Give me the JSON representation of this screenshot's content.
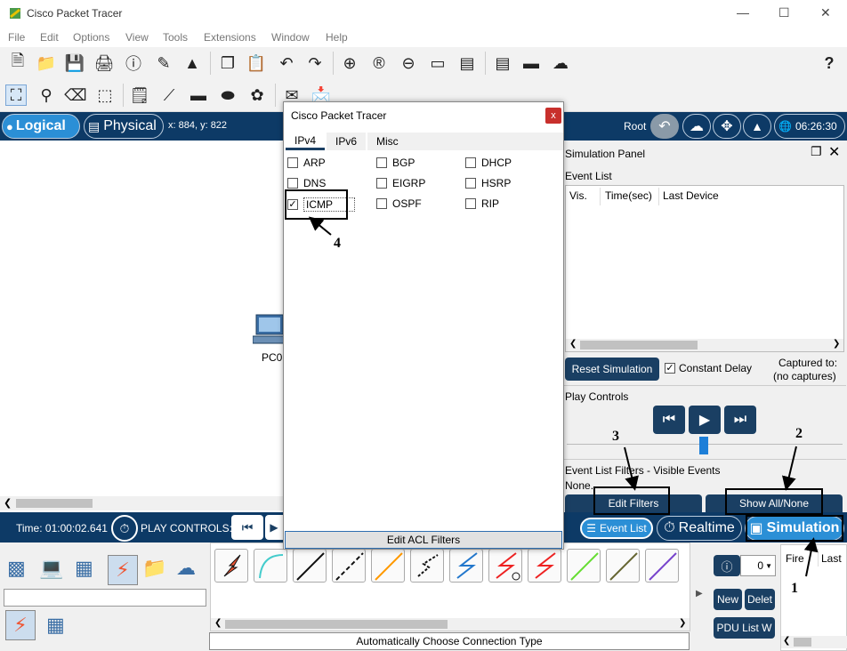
{
  "app": {
    "title": "Cisco Packet Tracer"
  },
  "menu": [
    "File",
    "Edit",
    "Options",
    "View",
    "Tools",
    "Extensions",
    "Window",
    "Help"
  ],
  "icons": {
    "toolbar1": [
      "new-file-icon",
      "open-folder-icon",
      "save-icon",
      "print-icon",
      "info-icon",
      "activity-wizard-icon",
      "network-info-icon",
      "copy-icon",
      "paste-icon",
      "undo-icon",
      "redo-icon",
      "zoom-in-icon",
      "zoom-reset-icon",
      "zoom-out-icon",
      "drawing-palette-icon",
      "custom-devices-icon",
      "viewport-icon",
      "pdu-icon",
      "cloud-icon",
      "help-icon"
    ],
    "toolbar2": [
      "select-icon",
      "inspect-icon",
      "delete-icon",
      "resize-icon",
      "note-icon",
      "line-icon",
      "rectangle-icon",
      "ellipse-icon",
      "freeform-icon",
      "add-simple-pdu-icon",
      "add-complex-pdu-icon"
    ]
  },
  "navbar": {
    "logical": "Logical",
    "physical": "Physical",
    "coords": "x: 884, y: 822",
    "root": "Root",
    "clock": "06:26:30"
  },
  "canvas": {
    "device_label": "PC0"
  },
  "sim_panel": {
    "title": "Simulation Panel",
    "event_list_label": "Event List",
    "columns": [
      "Vis.",
      "Time(sec)",
      "Last Device"
    ],
    "reset_button": "Reset Simulation",
    "constant_delay": "Constant Delay",
    "captured_to": "Captured to:",
    "no_captures": "(no captures)",
    "play_controls": "Play Controls",
    "filters_label": "Event List Filters - Visible Events",
    "filters_value": "None.",
    "edit_filters": "Edit Filters",
    "show_all": "Show All/None"
  },
  "bottombar": {
    "time": "Time: 01:00:02.641",
    "play_controls": "PLAY CONTROLS:",
    "event_list": "Event List",
    "realtime": "Realtime",
    "simulation": "Simulation"
  },
  "devpanel": {
    "status": "Automatically Choose Connection Type",
    "new": "New",
    "delete": "Delet",
    "pdu_list": "PDU List W",
    "pdu_select": "0",
    "col_fire": "Fire",
    "col_last": "Last"
  },
  "dialog": {
    "title": "Cisco Packet Tracer",
    "close": "x",
    "tabs": [
      "IPv4",
      "IPv6",
      "Misc"
    ],
    "protocols": [
      {
        "name": "ARP",
        "checked": false
      },
      {
        "name": "BGP",
        "checked": false
      },
      {
        "name": "DHCP",
        "checked": false
      },
      {
        "name": "DNS",
        "checked": false
      },
      {
        "name": "EIGRP",
        "checked": false
      },
      {
        "name": "HSRP",
        "checked": false
      },
      {
        "name": "ICMP",
        "checked": true
      },
      {
        "name": "OSPF",
        "checked": false
      },
      {
        "name": "RIP",
        "checked": false
      }
    ],
    "acl_button": "Edit ACL Filters"
  },
  "annotations": [
    "1",
    "2",
    "3",
    "4"
  ],
  "colors": {
    "navy": "#0d3a66",
    "accent": "#1a3f63",
    "highlight": "#2b8fd6",
    "close_red": "#c8302c"
  }
}
